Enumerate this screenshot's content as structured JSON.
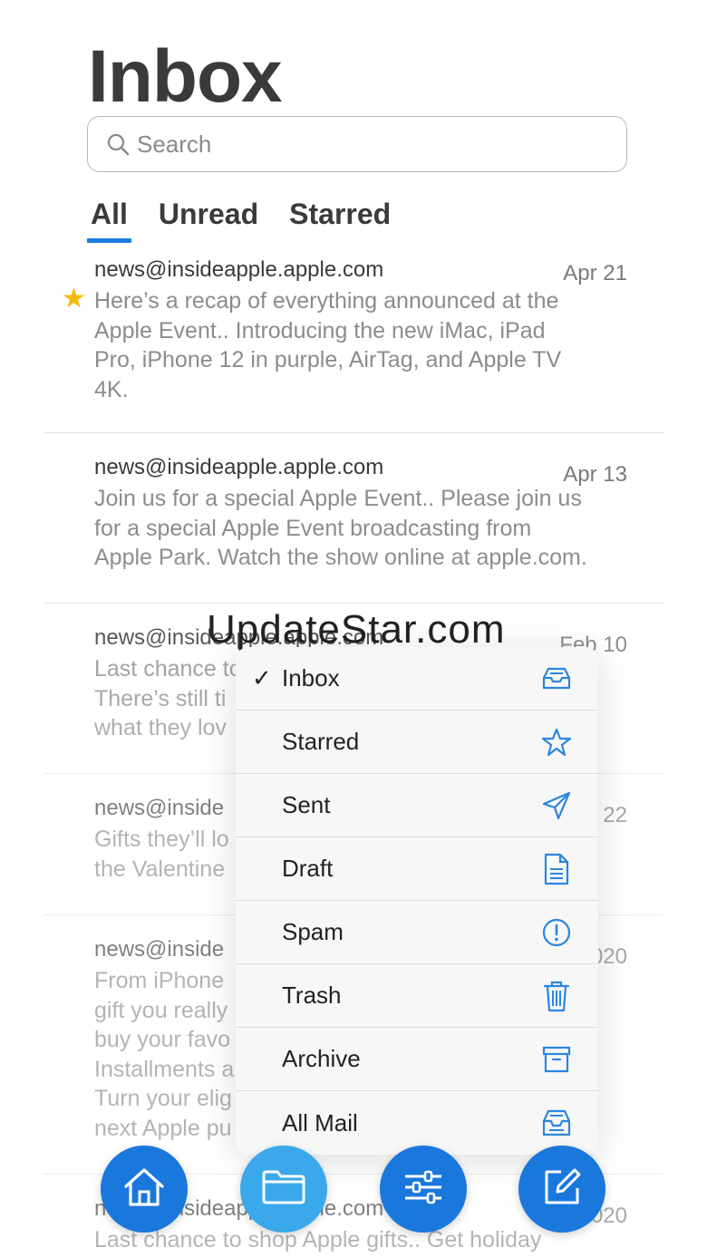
{
  "page": {
    "title": "Inbox"
  },
  "search": {
    "placeholder": "Search"
  },
  "tabs": [
    {
      "label": "All",
      "active": true
    },
    {
      "label": "Unread",
      "active": false
    },
    {
      "label": "Starred",
      "active": false
    }
  ],
  "emails": [
    {
      "from": "news@insideapple.apple.com",
      "date": "Apr 21",
      "starred": true,
      "snippet_lines": [
        "Here’s a recap of everything announced at the",
        "Apple Event..  Introducing the new iMac, iPad",
        "Pro, iPhone 12 in purple, AirTag, and Apple TV",
        "4K."
      ]
    },
    {
      "from": "news@insideapple.apple.com",
      "date": "Apr 13",
      "starred": false,
      "snippet_lines": [
        "Join us for a special Apple Event..  Please join us",
        "for a special Apple Event broadcasting from",
        "Apple Park. Watch the show online at apple.com."
      ]
    },
    {
      "from": "news@insideapple.apple.com",
      "date": "Feb 10",
      "starred": false,
      "snippet_lines": [
        "Last chance to",
        "There’s still ti",
        "what they lov"
      ]
    },
    {
      "from": "news@inside",
      "date": "22",
      "starred": false,
      "snippet_lines": [
        "Gifts they’ll lo",
        "the Valentine"
      ]
    },
    {
      "from": "news@inside",
      "date": "020",
      "starred": false,
      "snippet_lines": [
        "From iPhone",
        "gift you really",
        "buy your favo",
        "Installments a",
        "Turn your elig",
        "next Apple pu"
      ]
    },
    {
      "from": "news@insideapple.apple.com",
      "date": "Dec 2020",
      "starred": false,
      "snippet_lines": [
        "Last chance to shop Apple gifts..  Get holiday"
      ]
    }
  ],
  "watermark": "UpdateStar.com",
  "folder_menu": {
    "checkmark": "✓",
    "items": [
      {
        "label": "Inbox",
        "icon": "inbox-tray-icon",
        "selected": true
      },
      {
        "label": "Starred",
        "icon": "star-outline-icon",
        "selected": false
      },
      {
        "label": "Sent",
        "icon": "paper-plane-icon",
        "selected": false
      },
      {
        "label": "Draft",
        "icon": "document-icon",
        "selected": false
      },
      {
        "label": "Spam",
        "icon": "exclamation-circle-icon",
        "selected": false
      },
      {
        "label": "Trash",
        "icon": "trash-icon",
        "selected": false
      },
      {
        "label": "Archive",
        "icon": "archive-box-icon",
        "selected": false
      },
      {
        "label": "All Mail",
        "icon": "all-mail-tray-icon",
        "selected": false
      }
    ]
  },
  "bottom_actions": [
    {
      "name": "home",
      "icon": "home-icon",
      "color": "#1a78dc"
    },
    {
      "name": "folders",
      "icon": "folder-icon",
      "color": "#3aa8ea"
    },
    {
      "name": "filters",
      "icon": "sliders-icon",
      "color": "#1a78dc"
    },
    {
      "name": "compose",
      "icon": "compose-icon",
      "color": "#1a78dc"
    }
  ],
  "colors": {
    "accent": "#1a7de0",
    "star": "#f5b800",
    "icon_blue": "#2a86e0"
  }
}
